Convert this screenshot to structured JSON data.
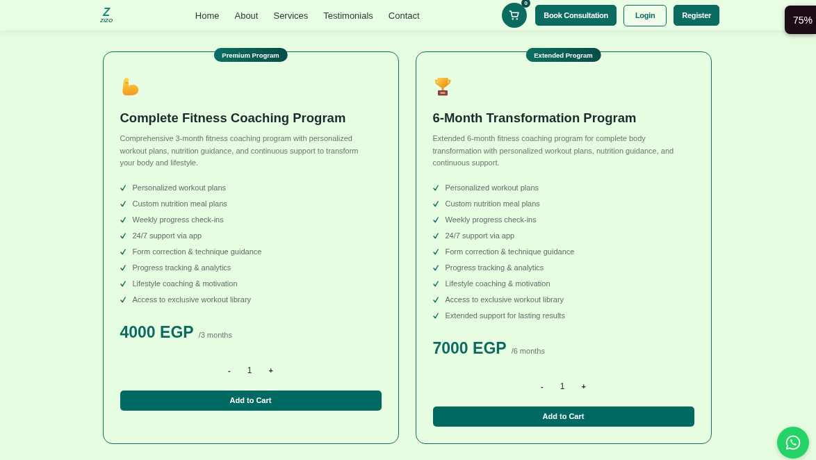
{
  "header": {
    "logo": {
      "mark": "Z",
      "caption": "ZIZO"
    },
    "nav": [
      {
        "label": "Home"
      },
      {
        "label": "About"
      },
      {
        "label": "Services"
      },
      {
        "label": "Testimonials"
      },
      {
        "label": "Contact"
      }
    ],
    "cart": {
      "count": "0"
    },
    "buttons": [
      {
        "label": "Book Consultation",
        "kind": "filled"
      },
      {
        "label": "Login",
        "kind": "outline"
      },
      {
        "label": "Register",
        "kind": "filled"
      }
    ]
  },
  "zoom_badge": "75%",
  "programs": [
    {
      "badge": "Premium Program",
      "title": "Complete Fitness Coaching Program",
      "description": "Comprehensive 3-month fitness coaching program with personalized workout plans, nutrition guidance, and continuous support to transform your body and lifestyle.",
      "features": [
        "Personalized workout plans",
        "Custom nutrition meal plans",
        "Weekly progress check-ins",
        "24/7 support via app",
        "Form correction & technique guidance",
        "Progress tracking & analytics",
        "Lifestyle coaching & motivation",
        "Access to exclusive workout library"
      ],
      "price": "4000 EGP",
      "period": "/3 months",
      "quantity": {
        "decrement": "-",
        "value": "1",
        "increment": "+"
      },
      "button": "Add to Cart"
    },
    {
      "badge": "Extended Program",
      "title": "6-Month Transformation Program",
      "description": "Extended 6-month fitness coaching program for complete body transformation with personalized workout plans, nutrition guidance, and continuous support.",
      "features": [
        "Personalized workout plans",
        "Custom nutrition meal plans",
        "Weekly progress check-ins",
        "24/7 support via app",
        "Form correction & technique guidance",
        "Progress tracking & analytics",
        "Lifestyle coaching & motivation",
        "Access to exclusive workout library",
        "Extended support for lasting results"
      ],
      "price": "7000 EGP",
      "period": "/6 months",
      "quantity": {
        "decrement": "-",
        "value": "1",
        "increment": "+"
      },
      "button": "Add to Cart"
    }
  ]
}
